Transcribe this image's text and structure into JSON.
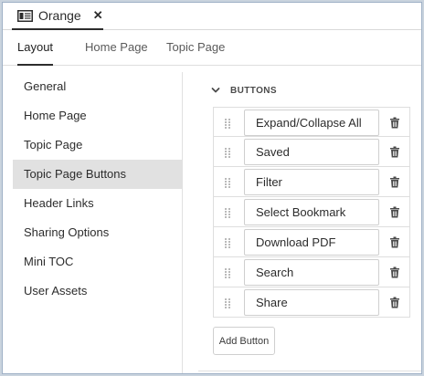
{
  "window": {
    "tab_title": "Orange",
    "close_glyph": "✕"
  },
  "subtabs": [
    {
      "label": "Layout",
      "active": true
    },
    {
      "label": "Home Page",
      "active": false
    },
    {
      "label": "Topic Page",
      "active": false
    }
  ],
  "sidebar": {
    "items": [
      {
        "label": "General",
        "selected": false
      },
      {
        "label": "Home Page",
        "selected": false
      },
      {
        "label": "Topic Page",
        "selected": false
      },
      {
        "label": "Topic Page Buttons",
        "selected": true
      },
      {
        "label": "Header Links",
        "selected": false
      },
      {
        "label": "Sharing Options",
        "selected": false
      },
      {
        "label": "Mini TOC",
        "selected": false
      },
      {
        "label": "User Assets",
        "selected": false
      }
    ]
  },
  "buttons_section": {
    "title": "BUTTONS",
    "expanded": true,
    "rows": [
      {
        "value": "Expand/Collapse All"
      },
      {
        "value": "Saved"
      },
      {
        "value": "Filter"
      },
      {
        "value": "Select Bookmark"
      },
      {
        "value": "Download PDF"
      },
      {
        "value": "Search"
      },
      {
        "value": "Share"
      }
    ],
    "add_label": "Add Button"
  },
  "icons": {
    "tab": "window-panel-icon",
    "close": "close-icon",
    "section_toggle": "chevron-down-icon",
    "drag": "drag-handle-icon",
    "delete": "trash-icon"
  }
}
